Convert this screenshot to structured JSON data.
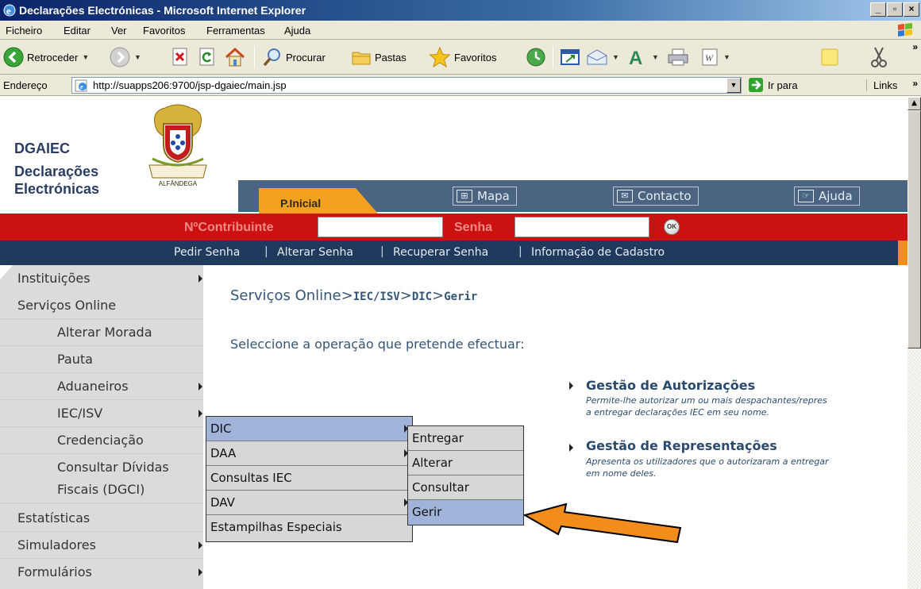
{
  "window": {
    "title": "Declarações Electrónicas - Microsoft Internet Explorer",
    "controls": {
      "minimize": "_",
      "maximize": "▫",
      "close": "×"
    }
  },
  "menubar": [
    "Ficheiro",
    "Editar",
    "Ver",
    "Favoritos",
    "Ferramentas",
    "Ajuda"
  ],
  "toolbar": {
    "back": "Retroceder",
    "search": "Procurar",
    "folders": "Pastas",
    "favorites": "Favoritos",
    "more": "»"
  },
  "address": {
    "label": "Endereço",
    "url": "http://suapps206:9700/jsp-dgaiec/main.jsp",
    "go": "Ir para",
    "links": "Links",
    "more": "»"
  },
  "site": {
    "org": "DGAIEC",
    "name_line1": "Declarações",
    "name_line2": "Electrónicas",
    "crest_motto": "ALFÂNDEGA",
    "tab_home": "P.Inicial",
    "nav": [
      {
        "label": "Mapa",
        "icon": "sitemap-icon"
      },
      {
        "label": "Contacto",
        "icon": "envelope-icon"
      },
      {
        "label": "Ajuda",
        "icon": "help-icon"
      }
    ],
    "login": {
      "nif_label": "NºContribuinte",
      "password_label": "Senha",
      "nif_value": "",
      "password_value": "",
      "ok": "OK"
    },
    "account_links": [
      "Pedir Senha",
      "Alterar Senha",
      "Recuperar Senha",
      "Informação de Cadastro"
    ],
    "separator": "|"
  },
  "leftnav": [
    {
      "label": "Instituições",
      "submenu": true,
      "indent": false
    },
    {
      "label": "Serviços Online",
      "submenu": false,
      "indent": false
    },
    {
      "label": "Alterar Morada",
      "submenu": false,
      "indent": true
    },
    {
      "label": "Pauta",
      "submenu": false,
      "indent": true
    },
    {
      "label": "Aduaneiros",
      "submenu": true,
      "indent": true
    },
    {
      "label": "IEC/ISV",
      "submenu": true,
      "indent": true
    },
    {
      "label": "Credenciação",
      "submenu": false,
      "indent": true
    },
    {
      "label": "Consultar Dívidas",
      "submenu": false,
      "indent": true
    },
    {
      "label": "Fiscais (DGCI)",
      "submenu": false,
      "indent": true
    },
    {
      "label": "Estatísticas",
      "submenu": false,
      "indent": false
    },
    {
      "label": "Simuladores",
      "submenu": true,
      "indent": false
    },
    {
      "label": "Formulários",
      "submenu": true,
      "indent": false
    }
  ],
  "content": {
    "breadcrumb_big": "Serviços Online>",
    "breadcrumb_iec": "IEC/ISV",
    "breadcrumb_gt1": ">",
    "breadcrumb_dic": "DIC",
    "breadcrumb_gt2": ">",
    "breadcrumb_last": "Gerir",
    "prompt": "Seleccione a operação que pretende efectuar:",
    "options": [
      {
        "title": "Gestão de Autorizações",
        "desc1": "Permite-lhe autorizar um ou mais despachantes/repres",
        "desc2": "a entregar declarações IEC em seu nome."
      },
      {
        "title": "Gestão de Representações",
        "desc1": "Apresenta os utilizadores que o autorizaram a entregar",
        "desc2": "em nome deles."
      }
    ]
  },
  "submenu1": [
    {
      "label": "DIC",
      "submenu": true,
      "highlight": true
    },
    {
      "label": "DAA",
      "submenu": true,
      "highlight": false
    },
    {
      "label": "Consultas IEC",
      "submenu": false,
      "highlight": false
    },
    {
      "label": "DAV",
      "submenu": true,
      "highlight": false
    },
    {
      "label": "Estampilhas Especiais",
      "submenu": false,
      "highlight": false
    }
  ],
  "submenu2": [
    {
      "label": "Entregar",
      "highlight": false
    },
    {
      "label": "Alterar",
      "highlight": false
    },
    {
      "label": "Consultar",
      "highlight": false
    },
    {
      "label": "Gerir",
      "highlight": true
    }
  ],
  "colors": {
    "login_band": "#cc1111",
    "links_band": "#1f3a5c",
    "nav_band": "#4a6482",
    "home_tab": "#f2a21e",
    "arrow": "#f28c1a",
    "menu_highlight": "#9fb4d8"
  }
}
